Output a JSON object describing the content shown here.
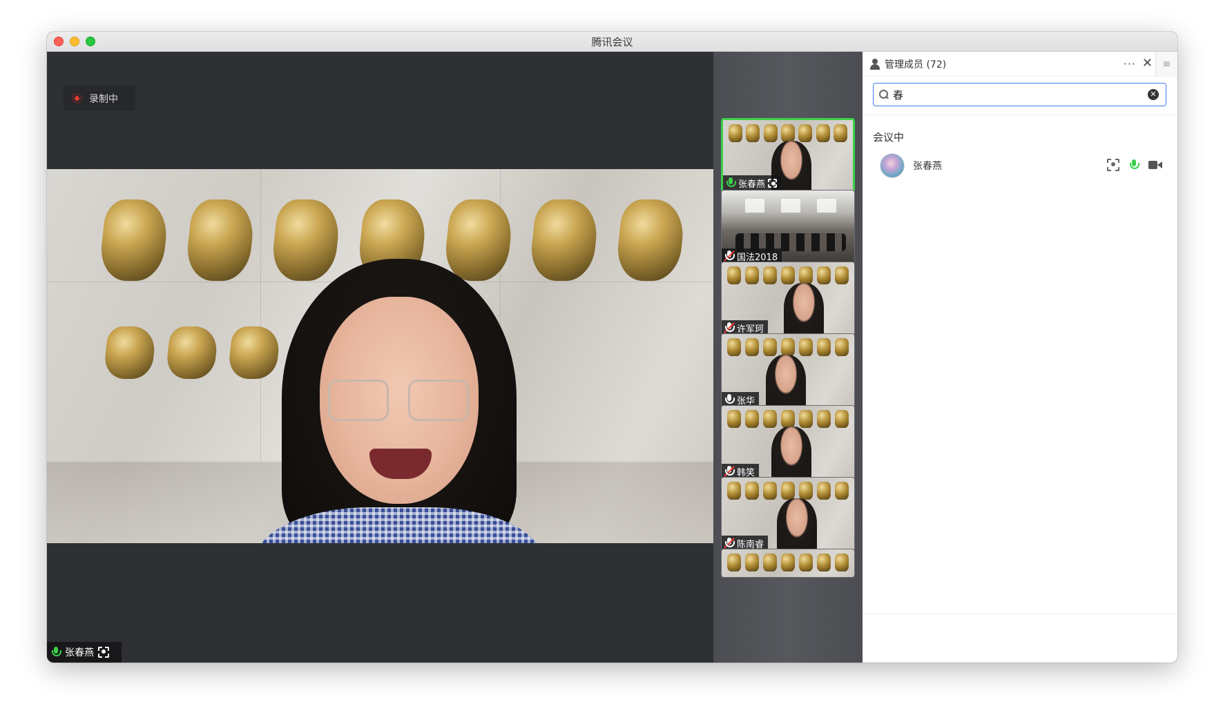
{
  "window": {
    "title": "腾讯会议"
  },
  "recording": {
    "label": "录制中"
  },
  "main_speaker": {
    "name": "张春燕"
  },
  "thumbnails": [
    {
      "name": "张春燕",
      "mic": "on",
      "active": true
    },
    {
      "name": "国法2018",
      "mic": "muted",
      "active": false
    },
    {
      "name": "许军珂",
      "mic": "muted",
      "active": false
    },
    {
      "name": "张华",
      "mic": "on-white",
      "active": false
    },
    {
      "name": "韩笑",
      "mic": "muted",
      "active": false
    },
    {
      "name": "陈南睿",
      "mic": "muted",
      "active": false
    },
    {
      "name": "",
      "mic": "",
      "active": false
    }
  ],
  "panel": {
    "title": "管理成员 (72)",
    "more_label": "···",
    "close_label": "✕",
    "menu_label": "≡",
    "search": {
      "value": "春",
      "placeholder": ""
    },
    "section": "会议中",
    "members": [
      {
        "name": "张春燕"
      }
    ]
  },
  "colors": {
    "accent": "#3d7bf0",
    "mic_on": "#3bd04a",
    "active_border": "#3bd04a",
    "rec_dot": "#e03c33"
  }
}
